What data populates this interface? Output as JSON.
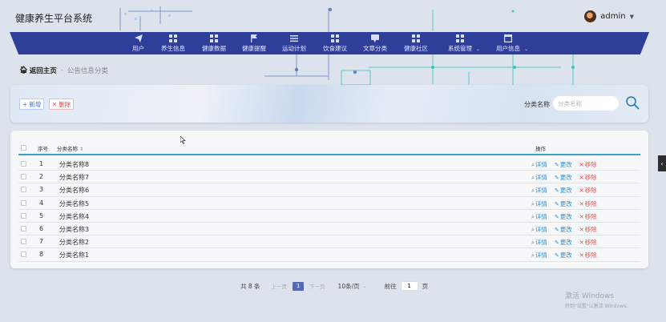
{
  "app": {
    "title": "健康养生平台系统"
  },
  "user": {
    "name": "admin"
  },
  "nav": {
    "items": [
      {
        "label": "用户",
        "icon": "send-icon"
      },
      {
        "label": "养生信息",
        "icon": "grid-icon"
      },
      {
        "label": "健康数据",
        "icon": "grid-icon"
      },
      {
        "label": "健康提醒",
        "icon": "flag-icon"
      },
      {
        "label": "运动计划",
        "icon": "list-icon"
      },
      {
        "label": "饮食建议",
        "icon": "grid-icon"
      },
      {
        "label": "文章分类",
        "icon": "chat-icon"
      },
      {
        "label": "健康社区",
        "icon": "grid-icon"
      },
      {
        "label": "系统管理",
        "icon": "grid-icon"
      },
      {
        "label": "用户信息",
        "icon": "window-icon"
      }
    ]
  },
  "breadcrumb": {
    "home": "返回主页",
    "separator": "-",
    "current": "公告信息分类"
  },
  "toolbar": {
    "add_label": "新增",
    "delete_label": "删除"
  },
  "search": {
    "label": "分类名称",
    "placeholder": "分类名称"
  },
  "table": {
    "headers": {
      "index": "序号",
      "name": "分类名称",
      "ops": "操作"
    },
    "rows": [
      {
        "index": "1",
        "name": "分类名称8"
      },
      {
        "index": "2",
        "name": "分类名称7"
      },
      {
        "index": "3",
        "name": "分类名称6"
      },
      {
        "index": "4",
        "name": "分类名称5"
      },
      {
        "index": "5",
        "name": "分类名称4"
      },
      {
        "index": "6",
        "name": "分类名称3"
      },
      {
        "index": "7",
        "name": "分类名称2"
      },
      {
        "index": "8",
        "name": "分类名称1"
      }
    ],
    "ops": {
      "detail": "详情",
      "edit": "更改",
      "remove": "移除"
    }
  },
  "pagination": {
    "total": "共 8 条",
    "prev": "上一页",
    "current_page": "1",
    "next": "下一页",
    "page_size": "10条/页",
    "goto_label": "前往",
    "goto_value": "1",
    "page_suffix": "页"
  },
  "watermark": {
    "line1": "激活 Windows",
    "line2": "转到\"设置\"以激活 Windows。"
  },
  "colors": {
    "nav_bg": "#2f3e98",
    "accent": "#3aa2c9",
    "danger": "#e04848",
    "page_active": "#5468b8"
  }
}
